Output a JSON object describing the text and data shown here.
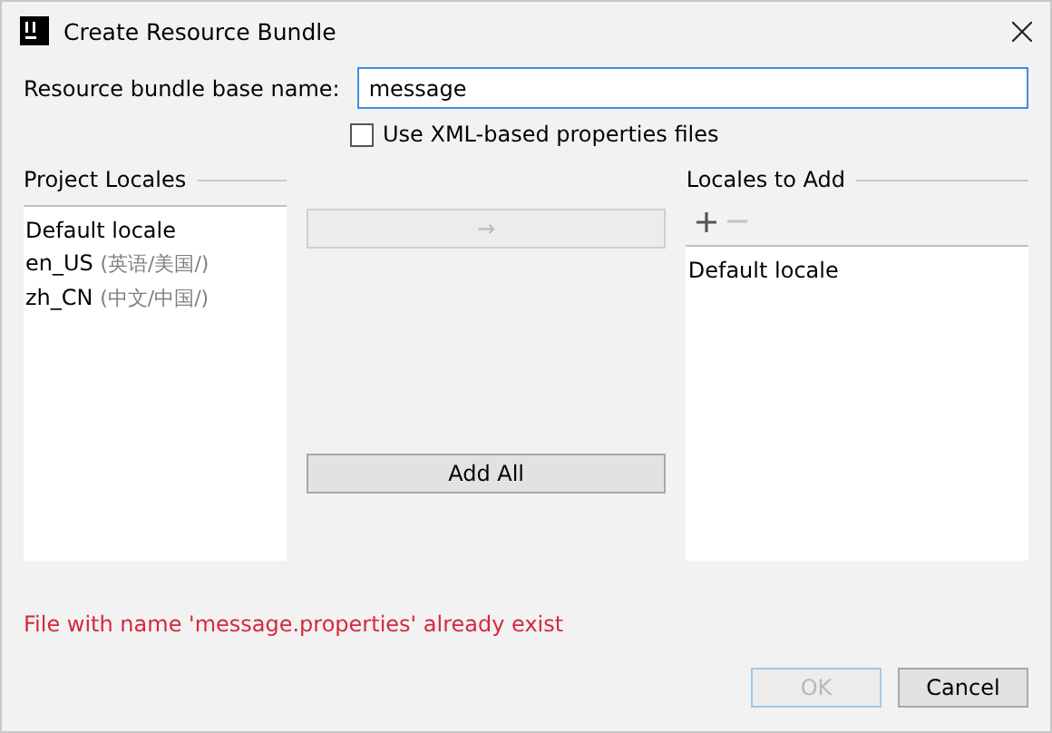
{
  "window": {
    "title": "Create Resource Bundle"
  },
  "name_field": {
    "label": "Resource bundle base name:",
    "value": "message"
  },
  "xml_checkbox": {
    "label": "Use XML-based properties files",
    "checked": false
  },
  "project_locales": {
    "title": "Project Locales",
    "items": [
      {
        "code": "Default locale"
      },
      {
        "code": "en_US",
        "detail": "(英语/美国/)"
      },
      {
        "code": "zh_CN",
        "detail": "(中文/中国/)"
      }
    ]
  },
  "move_button": {
    "label": "→",
    "disabled": true
  },
  "add_all_button": {
    "label": "Add All",
    "disabled": false
  },
  "locales_to_add": {
    "title": "Locales to Add",
    "toolbar": [
      {
        "kind": "add",
        "disabled": false
      },
      {
        "kind": "remove",
        "disabled": true
      }
    ],
    "items": [
      {
        "code": "Default locale"
      }
    ]
  },
  "error": "File with name 'message.properties' already exist",
  "buttons": [
    {
      "label": "OK",
      "disabled": true
    },
    {
      "label": "Cancel",
      "disabled": false
    }
  ]
}
